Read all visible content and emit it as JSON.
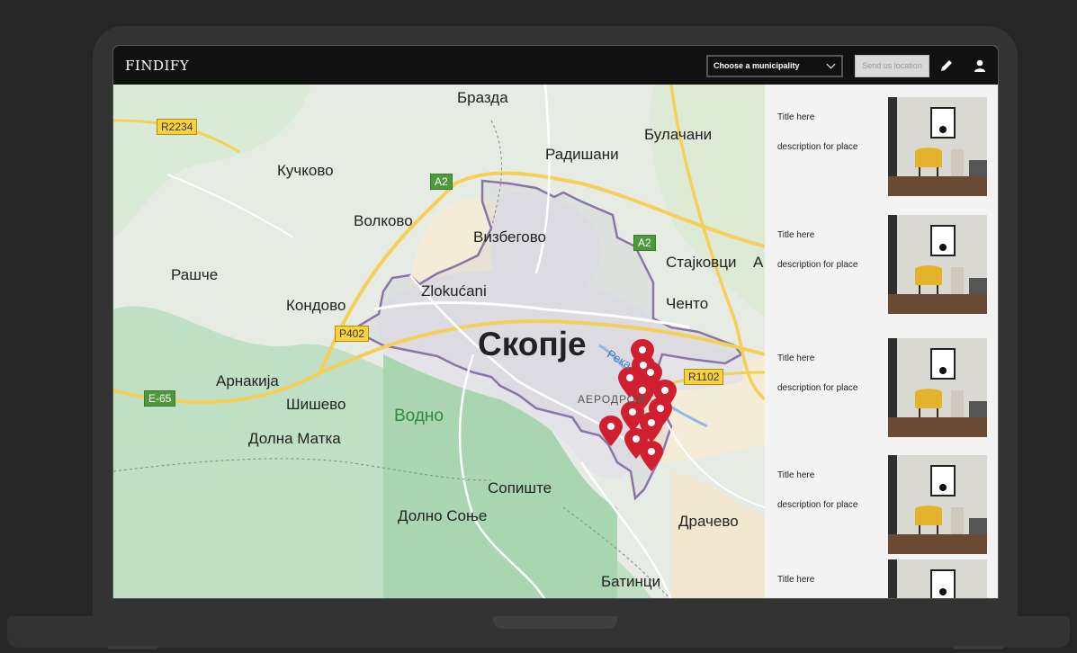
{
  "app": {
    "brand": "FINDIFY"
  },
  "navbar": {
    "municipality_select": {
      "value": "Choose a municipality"
    },
    "send_location_label": "Send us location",
    "edit_icon": "pencil-icon",
    "account_icon": "user-icon"
  },
  "map": {
    "city": "Скопје",
    "district": "АЕРОДРОМ",
    "river": "Река",
    "places": [
      {
        "name": "Бразда"
      },
      {
        "name": "Булачани"
      },
      {
        "name": "Радишани"
      },
      {
        "name": "Кучково"
      },
      {
        "name": "Волково"
      },
      {
        "name": "Визбегово"
      },
      {
        "name": "Стајковци"
      },
      {
        "name": "Рашче"
      },
      {
        "name": "Zlokućani"
      },
      {
        "name": "Кондово"
      },
      {
        "name": "Ченто"
      },
      {
        "name": "Арнакија"
      },
      {
        "name": "Шишево"
      },
      {
        "name": "Долна Матка"
      },
      {
        "name": "Сопиште"
      },
      {
        "name": "Долно Соње"
      },
      {
        "name": "Драчево"
      },
      {
        "name": "Батинци"
      }
    ],
    "park": "Водно",
    "roads": [
      "R2234",
      "A2",
      "A2",
      "P402",
      "E-65",
      "R1102"
    ],
    "edge_letter": "A",
    "marker_color": "#d0202f",
    "marker_count": 12
  },
  "sidebar": {
    "cards": [
      {
        "title": "Title here",
        "description": "description for place"
      },
      {
        "title": "Title here",
        "description": "description for place"
      },
      {
        "title": "Title here",
        "description": "description for place"
      },
      {
        "title": "Title here",
        "description": "description for place"
      },
      {
        "title": "Title here",
        "description": ""
      }
    ]
  }
}
